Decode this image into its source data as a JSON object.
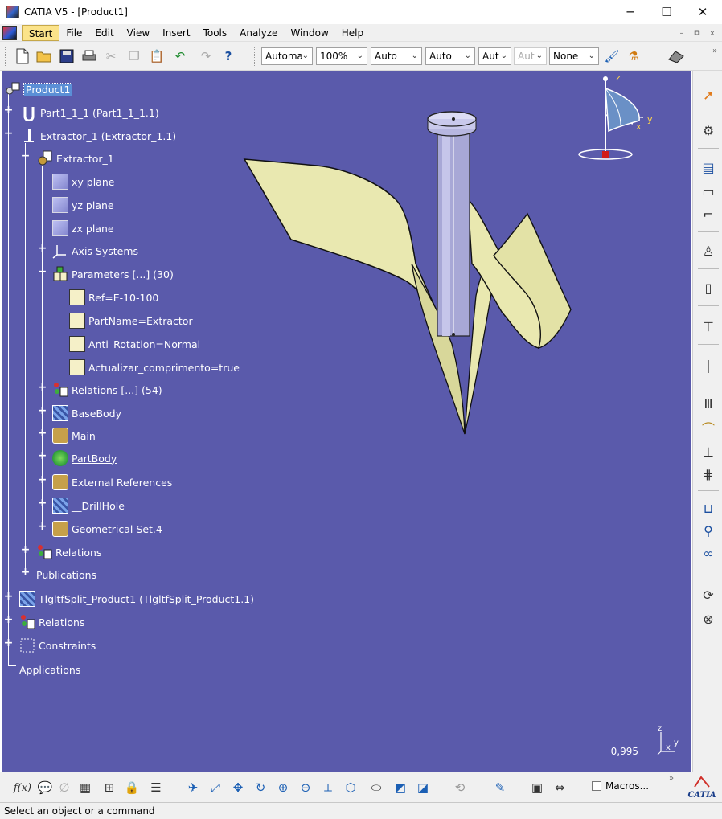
{
  "window": {
    "title": "CATIA V5 - [Product1]",
    "controls": {
      "minimize": "─",
      "maximize": "☐",
      "close": "✕"
    }
  },
  "menubar": {
    "items": [
      {
        "label": "Start"
      },
      {
        "label": "File"
      },
      {
        "label": "Edit"
      },
      {
        "label": "View"
      },
      {
        "label": "Insert"
      },
      {
        "label": "Tools"
      },
      {
        "label": "Analyze"
      },
      {
        "label": "Window"
      },
      {
        "label": "Help"
      }
    ],
    "mdi_controls": {
      "minimize": "–",
      "restore": "⧉",
      "close": "x"
    }
  },
  "toolbar": {
    "selects": [
      {
        "value": "Automa"
      },
      {
        "value": "100%"
      },
      {
        "value": "Auto"
      },
      {
        "value": "Auto"
      },
      {
        "value": "Aut"
      },
      {
        "value": "Aut",
        "disabled": true
      },
      {
        "value": "None"
      }
    ]
  },
  "tree": {
    "nodes": [
      {
        "label": "Product1"
      },
      {
        "label": "Part1_1_1 (Part1_1_1.1)"
      },
      {
        "label": "Extractor_1 (Extractor_1.1)"
      },
      {
        "label": "Extractor_1"
      },
      {
        "label": "xy plane"
      },
      {
        "label": "yz plane"
      },
      {
        "label": "zx plane"
      },
      {
        "label": "Axis Systems"
      },
      {
        "label": "Parameters [...] (30)"
      },
      {
        "label": "Ref=E-10-100"
      },
      {
        "label": "PartName=Extractor"
      },
      {
        "label": "Anti_Rotation=Normal"
      },
      {
        "label": "Actualizar_comprimento=true"
      },
      {
        "label": "Relations [...] (54)"
      },
      {
        "label": "BaseBody"
      },
      {
        "label": "Main"
      },
      {
        "label": "PartBody"
      },
      {
        "label": "External References"
      },
      {
        "label": "__DrillHole"
      },
      {
        "label": "Geometrical Set.4"
      },
      {
        "label": "Relations"
      },
      {
        "label": "Publications"
      },
      {
        "label": "TlgltfSplit_Product1 (TlgltfSplit_Product1.1)"
      },
      {
        "label": "Relations"
      },
      {
        "label": "Constraints"
      },
      {
        "label": "Applications"
      }
    ]
  },
  "compass": {
    "z": "z",
    "y": "y",
    "x": "x"
  },
  "viewport": {
    "zoom_readout": "0,995",
    "mini_axis": {
      "z": "z",
      "x": "x",
      "y": "y"
    }
  },
  "bottom_toolbar": {
    "macros_label": "Macros...",
    "fx_label": "f(x)",
    "catia_logo": "CATIA"
  },
  "statusbar": {
    "text": "Select an object or a command"
  },
  "colors": {
    "viewport_bg": "#5a5aab",
    "surface": "#e9e8b0",
    "selection": "#5b8fd6"
  }
}
